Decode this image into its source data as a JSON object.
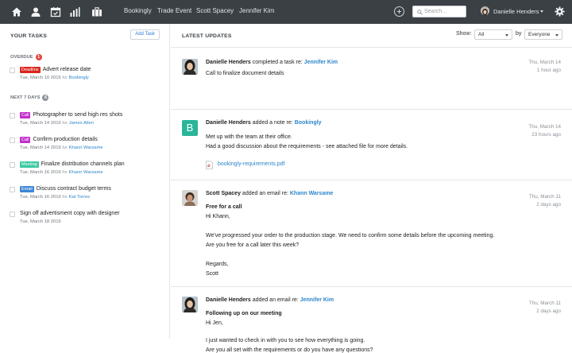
{
  "nav": {
    "links": [
      "Bookingly",
      "Trade Event",
      "Scott Spacey",
      "Jennifer Kim"
    ],
    "search_placeholder": "Search...",
    "user_name": "Danielle Henders",
    "icons": [
      "home-icon",
      "person-icon",
      "calendar-icon",
      "bar-chart-icon",
      "briefcase-icon",
      "plus-circle-icon",
      "search-icon",
      "gear-icon"
    ]
  },
  "tasks": {
    "title": "YOUR TASKS",
    "add_label": "Add Task",
    "overdue": {
      "label": "OVERDUE",
      "count": "1",
      "items": [
        {
          "tag": "Deadline",
          "tag_color": "#d9261c",
          "title": "Advert release date",
          "date": "Tue, March 10 2016",
          "for": "for",
          "who": "Bookingly"
        }
      ]
    },
    "next": {
      "label": "NEXT 7 DAYS",
      "count": "6",
      "items": [
        {
          "tag": "Call",
          "tag_color": "#c12ec9",
          "title": "Photographer to send high res shots",
          "date": "Tue, March 14 2016",
          "for": "for",
          "who": "James Allen"
        },
        {
          "tag": "Call",
          "tag_color": "#c12ec9",
          "title": "Confirm production details",
          "date": "Tue, March 14 2016",
          "for": "for",
          "who": "Khann Warsame"
        },
        {
          "tag": "Meeting",
          "tag_color": "#3dc9a0",
          "title": "Finalize distribution channels plan",
          "date": "Tue, March 16 2016",
          "for": "for",
          "who": "Khann Warsame"
        },
        {
          "tag": "Email",
          "tag_color": "#3d86d6",
          "title": "Discuss contract budget terms",
          "date": "Tue, March 16 2016",
          "for": "for",
          "who": "Kat Torres"
        },
        {
          "tag": "",
          "tag_color": "",
          "title": "Sign off advertisment copy with designer",
          "date": "Tue, March 18 2016",
          "for": "",
          "who": ""
        }
      ]
    }
  },
  "updates": {
    "title": "LATEST UPDATES",
    "show_label": "Show:",
    "show_value": "All",
    "by_label": "by",
    "by_value": "Everyone",
    "items": [
      {
        "name": "Danielle Henders",
        "action": "completed a task re:",
        "link": "Jennifer Kim",
        "date": "Thu, March 14",
        "ago": "1 hour ago",
        "lines": [
          "Call to finalize document details"
        ]
      },
      {
        "name": "Danielle Henders",
        "action": "added a note re:",
        "link": "Bookingly",
        "date": "Thu, March 14",
        "ago": "23 hours ago",
        "avatar_letter": "B",
        "lines": [
          "Met up with the team at their office.",
          "Had a good discussion about the requirements - see attached file for more details."
        ],
        "attachment": "bookingly-requirements.pdf"
      },
      {
        "name": "Scott Spacey",
        "action": "added an email re:",
        "link": "Khann Warsame",
        "date": "Thu, March 11",
        "ago": "2 days ago",
        "subject": "Free for a call",
        "lines": [
          "Hi Khann,",
          "We've progressed your order to the production stage. We need to confirm some details before the upcoming meeting.",
          "Are you free for a call later this week?",
          "Regards,",
          "Scott"
        ]
      },
      {
        "name": "Danielle Henders",
        "action": "added an email re:",
        "link": "Jennifer Kim",
        "date": "Thu, March 11",
        "ago": "2 days ago",
        "subject": "Following up on our meeting",
        "lines": [
          "Hi Jen,",
          "I just wanted to check in with you to see how everything is going.",
          "Are you all set with the requirements or do you have any questions?"
        ]
      }
    ]
  },
  "colors": {
    "topbar": "#3b4045",
    "link": "#2e86c9",
    "overdue_badge": "#e0473e",
    "next_badge": "#8d949b",
    "note_avatar": "#2bb59a"
  }
}
